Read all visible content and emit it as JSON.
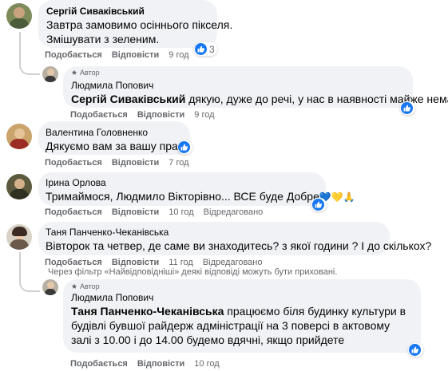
{
  "actions": {
    "like": "Подобається",
    "reply": "Відповісти",
    "edited": "Відредаговано"
  },
  "author_badge": "Автор",
  "comments": [
    {
      "author": "Сергій Сиваківський",
      "lines": [
        "Завтра замовимо осіннього пікселя.",
        "Змішувати з зеленим."
      ],
      "time": "9 год",
      "reactions": "3"
    },
    {
      "author": "Людмила Попович",
      "mention": "Сергій Сиваківський",
      "text": " дякую, дуже до речі, у нас в наявності майже немає",
      "time": "9 год"
    },
    {
      "author": "Валентина Головненко",
      "text": "Дякуємо вам за вашу працю",
      "time": "7 год"
    },
    {
      "author": "Ірина Орлова",
      "text": "Тримаймося, Людмило Вікторівно... ВСЕ буде Добре",
      "emoji": "💙💛🙏",
      "time": "10 год"
    },
    {
      "author": "Таня Панченко-Чеканівська",
      "text": "Вівторок та четвер, де саме ви знаходитесь? з якої години ? І до скількох?",
      "time": "11 год"
    },
    {
      "author": "Людмила Попович",
      "mention": "Таня Панченко-Чеканівська",
      "text": " працюємо біля будинку культури в будівлі бувшої райдерж адміністрації на 3 поверсі в актовому залі з 10.00 і до 14.00 будемо вдячні, якщо прийдете",
      "time": "10 год"
    }
  ],
  "filter_note": "Через фільтр «Найвідповідніші» деякі відповіді можуть бути приховані.",
  "colors": {
    "accent": "#1877f2",
    "bubble": "#f0f2f5",
    "meta": "#65676b"
  }
}
